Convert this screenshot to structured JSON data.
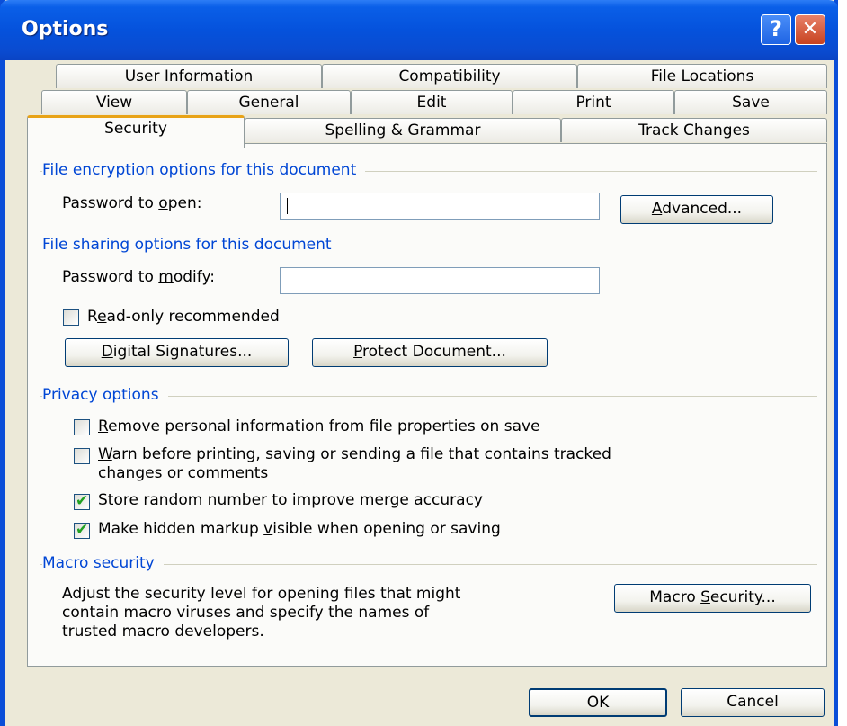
{
  "window": {
    "title": "Options"
  },
  "titlebar": {
    "help_glyph": "?",
    "close_glyph": "✕"
  },
  "tabs": {
    "row1": [
      "User Information",
      "Compatibility",
      "File Locations"
    ],
    "row2": [
      "View",
      "General",
      "Edit",
      "Print",
      "Save"
    ],
    "row3": [
      "Security",
      "Spelling & Grammar",
      "Track Changes"
    ],
    "active": "Security"
  },
  "encryption": {
    "title": "File encryption options for this document",
    "password_open_label_a": "Password to ",
    "password_open_label_u": "o",
    "password_open_label_b": "pen:",
    "password_open_value": "",
    "advanced_u": "A",
    "advanced_rest": "dvanced..."
  },
  "sharing": {
    "title": "File sharing options for this document",
    "password_modify_label_a": "Password to ",
    "password_modify_label_u": "m",
    "password_modify_label_b": "odify:",
    "password_modify_value": "",
    "readonly_u": "e",
    "readonly_a": "R",
    "readonly_b": "ad-only recommended",
    "readonly_checked": false,
    "digital_u": "D",
    "digital_rest": "igital Signatures...",
    "protect_u": "P",
    "protect_rest": "rotect Document..."
  },
  "privacy": {
    "title": "Privacy options",
    "items": [
      {
        "u": "R",
        "rest": "emove personal information from file properties on save",
        "checked": false
      },
      {
        "u": "W",
        "rest": "arn before printing, saving or sending a file that contains tracked",
        "line2": "changes or comments",
        "checked": false
      },
      {
        "pre": "S",
        "u": "t",
        "rest": "ore random number to improve merge accuracy",
        "checked": true
      },
      {
        "pre": "Make hidden markup ",
        "u": "v",
        "rest": "isible when opening or saving",
        "checked": true
      }
    ]
  },
  "macro": {
    "title": "Macro security",
    "description_1": "Adjust the security level for opening files that might",
    "description_2": "contain macro viruses and specify the names of",
    "description_3": "trusted macro developers.",
    "button_a": "Macro ",
    "button_u": "S",
    "button_b": "ecurity..."
  },
  "footer": {
    "ok": "OK",
    "cancel": "Cancel"
  }
}
